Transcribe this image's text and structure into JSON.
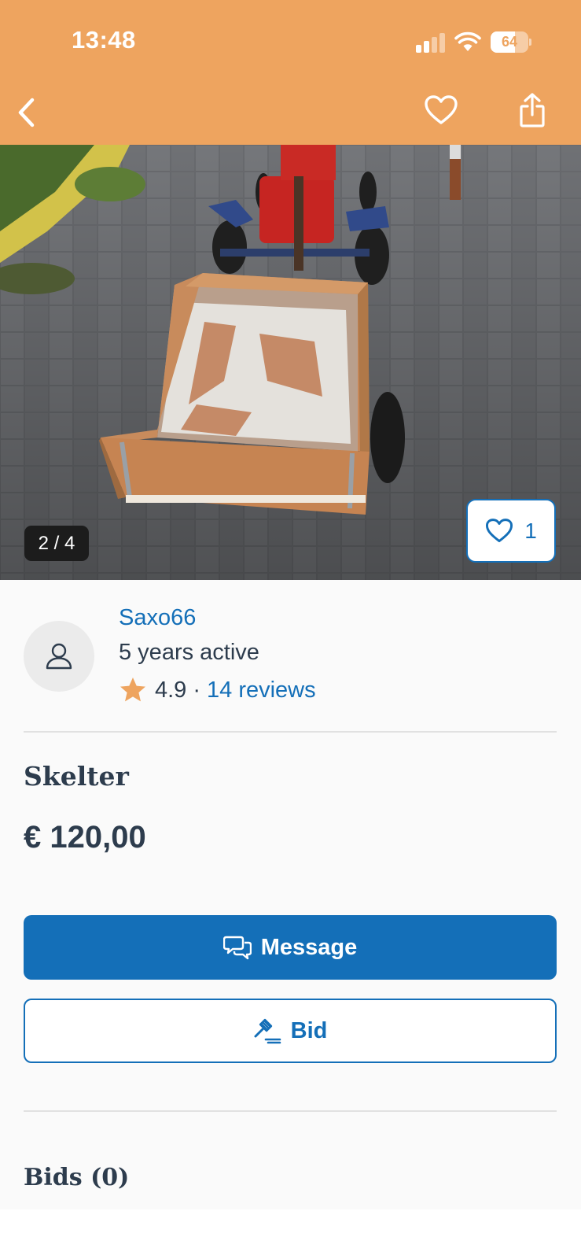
{
  "status_bar": {
    "time": "13:48",
    "battery": "64",
    "battery_level": 0.64,
    "signal_bars": 2,
    "icons": [
      "signal-icon",
      "wifi-icon",
      "battery-icon"
    ]
  },
  "nav": {
    "icons": [
      "back-chevron-icon",
      "heart-icon",
      "share-icon"
    ]
  },
  "gallery": {
    "counter": "2 / 4",
    "favorites_count": "1",
    "image_alt": "Wooden trailer box attached to a red go-kart on paving stones"
  },
  "seller": {
    "name": "Saxo66",
    "active": "5 years active",
    "rating": "4.9",
    "separator": "·",
    "reviews": "14 reviews",
    "avatar_icon": "user-icon",
    "star_icon": "star-icon"
  },
  "listing": {
    "title": "Skelter",
    "price": "€ 120,00"
  },
  "actions": {
    "message_label": "Message",
    "bid_label": "Bid",
    "message_icon": "chat-bubbles-icon",
    "bid_icon": "gavel-icon"
  },
  "bids": {
    "title": "Bids (0)"
  },
  "colors": {
    "header": "#EEA45F",
    "primary": "#146fb8",
    "text": "#2d3c4d",
    "star": "#EEA45F"
  }
}
